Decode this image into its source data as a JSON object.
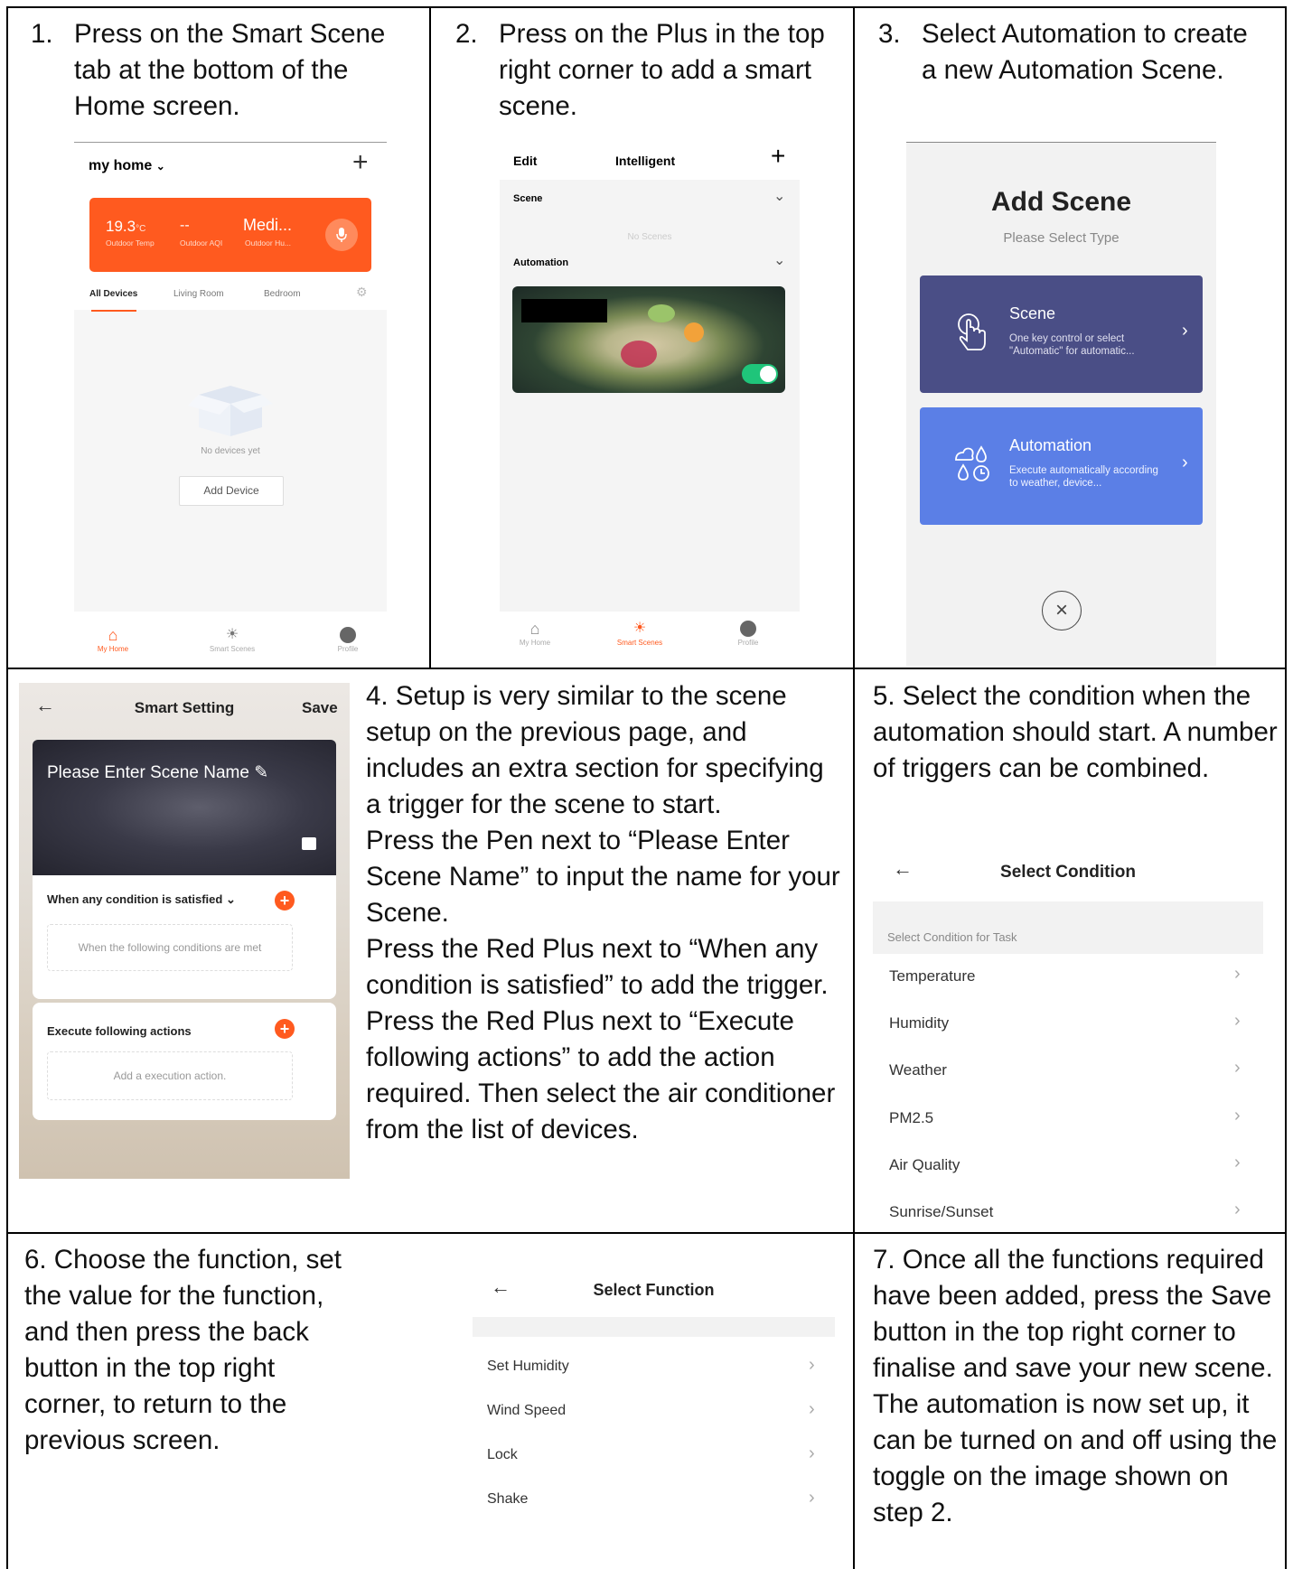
{
  "steps": {
    "s1": {
      "num": "1.",
      "text": "Press on the Smart Scene tab at the bottom of the Home screen."
    },
    "s2": {
      "num": "2.",
      "text": "Press on the Plus in the top right corner to add a smart scene."
    },
    "s3": {
      "num": "3.",
      "text": "Select Automation to create a new Automation Scene."
    },
    "s4": [
      "4. Setup is very similar to the scene setup on the previous page, and includes an extra section for specifying a trigger for the scene to start.",
      "Press the Pen next to “Please Enter Scene Name” to input the name for your Scene.",
      "Press the Red Plus next to “When any condition is satisfied” to add the trigger.",
      "Press the Red Plus next to “Execute following actions” to add the action required.  Then select the air conditioner from the list of devices."
    ],
    "s5": "5. Select the condition when the automation should start.  A number of triggers can be combined.",
    "s6": "6. Choose the function, set the value for the function, and then press the back button in the top right corner, to return to the previous screen.",
    "s7": [
      "7. Once all the functions required have been added, press the Save button in the top right corner to finalise and save your new scene.",
      "The automation is now set up, it can be turned on and off using the toggle on the image shown on step 2."
    ]
  },
  "screen1": {
    "home_name": "my home",
    "plus": "+",
    "temp": "19.3",
    "temp_unit": "°C",
    "aqi": "--",
    "humidity": "Medi...",
    "temp_label": "Outdoor Temp",
    "aqi_label": "Outdoor AQI",
    "hum_label": "Outdoor Hu...",
    "tabs": [
      "All Devices",
      "Living Room",
      "Bedroom"
    ],
    "empty": "No devices yet",
    "add_device": "Add Device",
    "nav": [
      "My Home",
      "Smart Scenes",
      "Profile"
    ],
    "accent": "#ff5a1f"
  },
  "screen2": {
    "edit": "Edit",
    "title": "Intelligent",
    "plus": "+",
    "scene": "Scene",
    "no_scenes": "No Scenes",
    "automation": "Automation",
    "nav": [
      "My Home",
      "Smart Scenes",
      "Profile"
    ],
    "toggle_color": "#1fc57a"
  },
  "screen3": {
    "title": "Add Scene",
    "subtitle": "Please Select Type",
    "scene_title": "Scene",
    "scene_desc": "One key control or select \"Automatic\" for automatic...",
    "auto_title": "Automation",
    "auto_desc": "Execute automatically according to weather, device...",
    "scene_color": "#4a4e86",
    "auto_color": "#5b7fe6"
  },
  "screen4": {
    "title": "Smart Setting",
    "save": "Save",
    "name_placeholder": "Please Enter Scene Name",
    "condition_header": "When any condition is satisfied",
    "condition_placeholder": "When the following conditions are met",
    "action_header": "Execute following actions",
    "action_placeholder": "Add a execution action."
  },
  "screen5": {
    "title": "Select Condition",
    "section": "Select Condition for Task",
    "items": [
      "Temperature",
      "Humidity",
      "Weather",
      "PM2.5",
      "Air Quality",
      "Sunrise/Sunset"
    ]
  },
  "screen6": {
    "title": "Select Function",
    "items": [
      "Set Humidity",
      "Wind Speed",
      "Lock",
      "Shake"
    ]
  }
}
